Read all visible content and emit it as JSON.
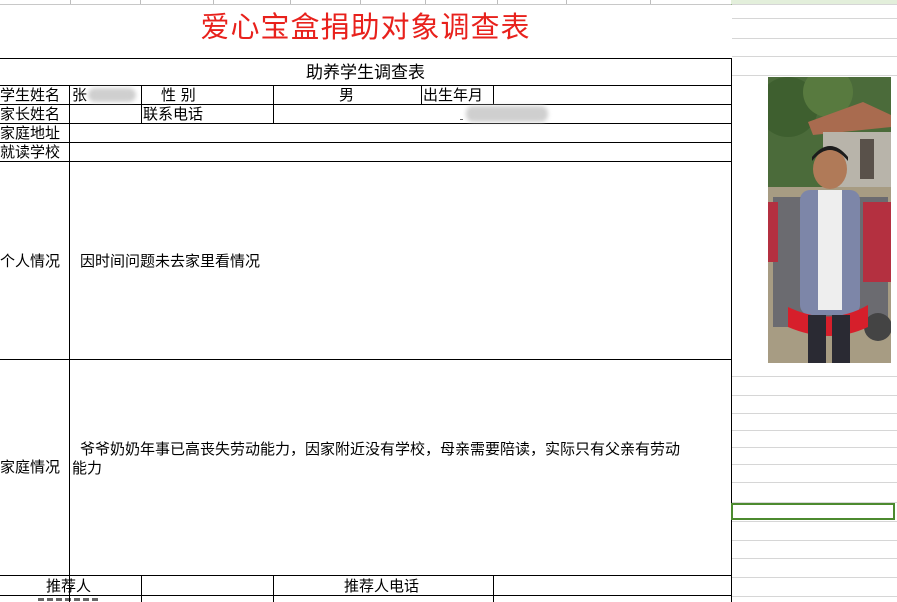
{
  "form": {
    "title": "爱心宝盒捐助对象调查表",
    "subtitle": "助养学生调查表",
    "labels": {
      "student_name": "学生姓名",
      "gender": "性 别",
      "birth": "出生年月",
      "parent_name": "家长姓名",
      "phone": "联系电话",
      "address": "家庭地址",
      "school": "就读学校",
      "personal": "个人情况",
      "family": "家庭情况",
      "recommender": "推荐人",
      "recommender_phone": "推荐人电话"
    },
    "values": {
      "student_name_prefix": "张",
      "gender": "男",
      "personal": "因时间问题未去家里看情况",
      "family_line1": "爷爷奶奶年事已高丧失劳动能力，因家附近没有学校，母亲需要陪读，实际只有父亲有劳动",
      "family_line2": "能力"
    }
  },
  "photo": {
    "subject": "boy-in-grey-jacket-photo"
  },
  "colors": {
    "title": "#e8211c",
    "selection": "#4c8a2f"
  }
}
